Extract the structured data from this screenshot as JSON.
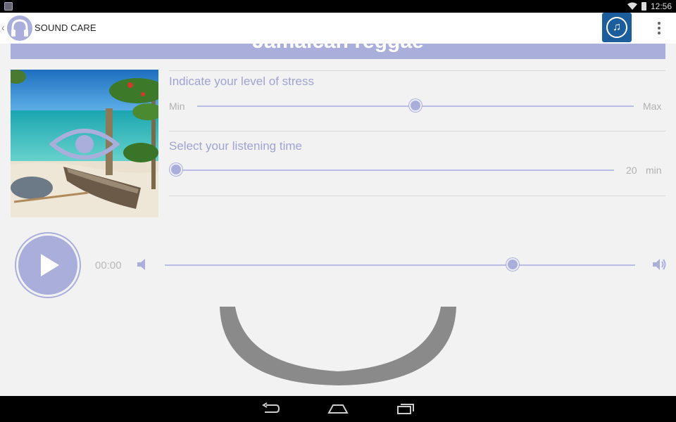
{
  "status_bar": {
    "time": "12:56",
    "icons": [
      "notification-icon",
      "wifi-icon",
      "battery-icon"
    ]
  },
  "action_bar": {
    "title": "SOUND CARE",
    "icons": [
      "back-chevron-icon",
      "headphones-logo-icon",
      "music-note-icon",
      "overflow-menu-icon"
    ]
  },
  "genre": {
    "title": "Jamaican reggae"
  },
  "stress": {
    "label": "Indicate your level of stress",
    "min_label": "Min",
    "max_label": "Max",
    "value_fraction": 0.5
  },
  "listening_time": {
    "label": "Select your listening time",
    "value": "20",
    "unit": "min",
    "value_fraction": 0.0
  },
  "player": {
    "elapsed": "00:00",
    "volume_fraction": 0.74,
    "icons": [
      "play-icon",
      "volume-low-icon",
      "volume-high-icon"
    ]
  },
  "colors": {
    "accent": "#a9aedb",
    "accent_text": "#9ea3d4",
    "music_button": "#1c5d9b",
    "background": "#f2f2f2"
  },
  "navigation": {
    "icons": [
      "nav-back-icon",
      "nav-home-icon",
      "nav-recents-icon"
    ]
  }
}
